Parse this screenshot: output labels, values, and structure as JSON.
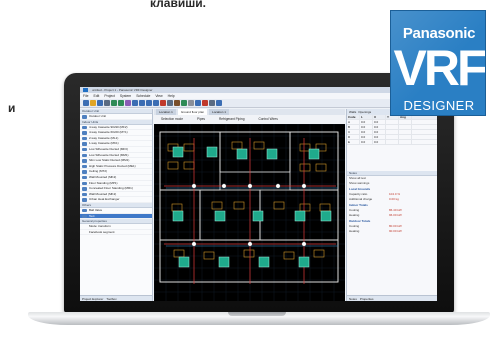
{
  "captions": {
    "top": "клавиши.",
    "left": "и"
  },
  "badge": {
    "brand": "Panasonic",
    "big": "VRF",
    "sub": "DESIGNER"
  },
  "app": {
    "title": "untitled - Project 1 - Panasonic VRF Designer",
    "menu": [
      "File",
      "Edit",
      "Project",
      "System",
      "Schedule",
      "View",
      "Help"
    ],
    "toolbar_icons": [
      "new-icon",
      "open-icon",
      "save-icon",
      "print-icon",
      "undo-icon",
      "redo-icon",
      "cut-icon",
      "copy-icon",
      "paste-icon",
      "zoom-in-icon",
      "zoom-out-icon",
      "select-icon",
      "line-icon",
      "wall-icon",
      "room-icon",
      "grid-icon",
      "layer-icon",
      "measure-icon",
      "settings-icon",
      "help-icon"
    ]
  },
  "sidebar": {
    "panel1_title": "Outdoor Unit",
    "outdoor_items": [
      "Outdoor Unit"
    ],
    "panel2_title": "Indoor Units",
    "indoor_items": [
      "4-way Cassette 90x90 (MF2)",
      "4-way Cassette 60x60 (MY1)",
      "2-way Cassette (ML1)",
      "1-way Cassette (MK1)",
      "Low Silhouette Ducted (MF3)",
      "Low Silhouette Ducted (MM1)",
      "Slim Low Static Ducted (MM1)",
      "High Static Pressure Ducted (ME1)",
      "Ceiling (MT2)",
      "Wall Mounted (MK2)",
      "Floor Standing (MP1)",
      "Concealed Floor Standing (MR1)",
      "Wall Mounted (MK2)",
      "Urban Heat Exchanger"
    ],
    "panel3_title": "Others",
    "other_items": [
      "Ball Valve",
      "Text"
    ],
    "panel4_title": "General properties",
    "general_items": [
      "Mode: transform",
      "Facebook segment"
    ],
    "bottom_tabs": [
      "Project Explorer",
      "Toolbox"
    ]
  },
  "center": {
    "doc_tabs": [
      "Location 1",
      "Ground floor plan",
      "Location 1"
    ],
    "plan_options": [
      "Selection mode",
      "Pipes",
      "Refrigerant Piping",
      "Control Wires"
    ]
  },
  "props": {
    "tabs": [
      "Walls",
      "Openings"
    ],
    "grid_headers": [
      "Code",
      "L",
      "X",
      "Y",
      "Ang"
    ],
    "grid_rows": [
      [
        "A",
        "0.0",
        "0.0",
        "",
        ""
      ],
      [
        "B",
        "0.0",
        "0.0",
        "",
        ""
      ],
      [
        "C",
        "0.0",
        "0.0",
        "",
        ""
      ],
      [
        "D",
        "0.0",
        "0.0",
        "",
        ""
      ],
      [
        "E",
        "0.0",
        "0.0",
        "",
        ""
      ]
    ],
    "section_title": "Notes",
    "notes": [
      "Show all text",
      "Show warnings"
    ],
    "capacity_title": "Local Grounds",
    "capacity_rows": [
      [
        "Capacity ratio",
        "104.0 %"
      ],
      [
        "Additional charge",
        "0.00 kg"
      ]
    ],
    "indoor_totals_title": "Indoor Totals",
    "indoor_totals": [
      [
        "Cooling",
        "86.40 kW"
      ],
      [
        "Heating",
        "96.00 kW"
      ]
    ],
    "outdoor_totals_title": "Outdoor Totals",
    "outdoor_totals": [
      [
        "Cooling",
        "80.00 kW"
      ],
      [
        "Heating",
        "90.00 kW"
      ]
    ],
    "bottom_tabs": [
      "Notes",
      "Properties"
    ]
  }
}
